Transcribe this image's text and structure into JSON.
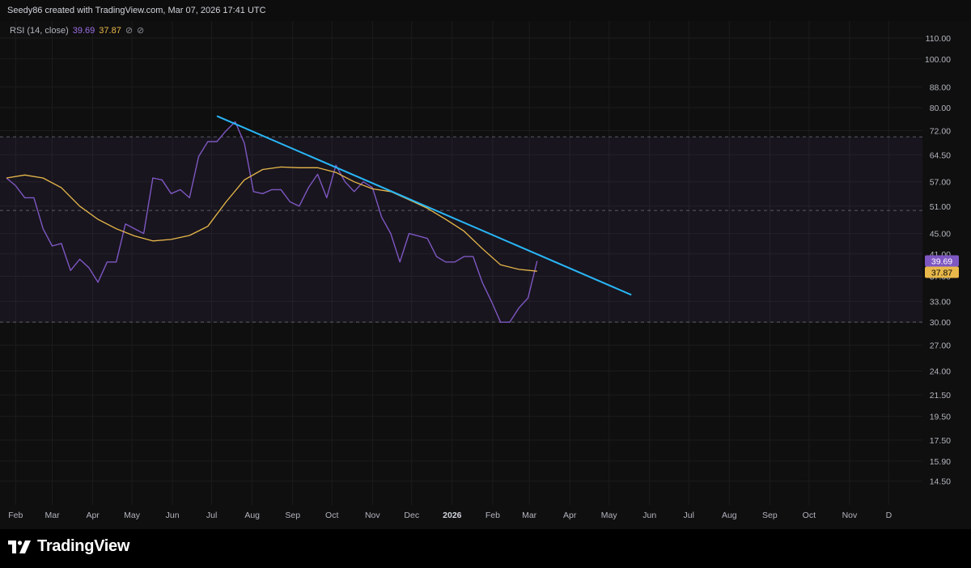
{
  "header": {
    "caption": "Seedy86 created with TradingView.com, Mar 07, 2026 17:41 UTC"
  },
  "indicator": {
    "label": "RSI (14, close)",
    "rsi_value": "39.69",
    "ma_value": "37.87",
    "icon_names": [
      "hide-icon",
      "hide-icon"
    ]
  },
  "brand": {
    "name": "TradingView"
  },
  "colors": {
    "rsi": "#7e57c2",
    "rsi_ma": "#e8b84a",
    "trendline": "#29b6f6",
    "band": "#7e57c2",
    "background": "#0f0f0f",
    "gridline": "#1c1c1c"
  },
  "chart_data": {
    "type": "line",
    "title": "",
    "xlabel": "",
    "ylabel": "",
    "y_scale": "log",
    "ylim": [
      13.5,
      115
    ],
    "y_ticks": [
      "110.00",
      "100.00",
      "88.00",
      "80.00",
      "72.00",
      "64.50",
      "57.00",
      "51.00",
      "45.00",
      "41.00",
      "37.00",
      "33.00",
      "30.00",
      "27.00",
      "24.00",
      "21.50",
      "19.50",
      "17.50",
      "15.90",
      "14.50"
    ],
    "x_ticks": [
      "Feb",
      "Mar",
      "Apr",
      "May",
      "Jun",
      "Jul",
      "Aug",
      "Sep",
      "Oct",
      "Nov",
      "Dec",
      "2026",
      "Feb",
      "Mar",
      "Apr",
      "May",
      "Jun",
      "Jul",
      "Aug",
      "Sep",
      "Oct",
      "Nov",
      "D"
    ],
    "x_start": "2025-01-25",
    "x_end": "2026-12-28",
    "bands": {
      "upper": 70,
      "middle": 50,
      "lower": 30
    },
    "grid": true,
    "legend": "top-left",
    "series": [
      {
        "name": "RSI (14, close)",
        "points": [
          [
            "2025-01-25",
            58
          ],
          [
            "2025-02-01",
            56
          ],
          [
            "2025-02-08",
            53
          ],
          [
            "2025-02-15",
            53
          ],
          [
            "2025-02-22",
            46
          ],
          [
            "2025-03-01",
            42.5
          ],
          [
            "2025-03-08",
            43
          ],
          [
            "2025-03-15",
            38
          ],
          [
            "2025-03-22",
            40
          ],
          [
            "2025-03-29",
            38.5
          ],
          [
            "2025-04-05",
            36
          ],
          [
            "2025-04-12",
            39.5
          ],
          [
            "2025-04-19",
            39.5
          ],
          [
            "2025-04-26",
            47
          ],
          [
            "2025-05-03",
            46
          ],
          [
            "2025-05-10",
            45
          ],
          [
            "2025-05-17",
            58
          ],
          [
            "2025-05-24",
            57.5
          ],
          [
            "2025-05-31",
            54
          ],
          [
            "2025-06-07",
            55
          ],
          [
            "2025-06-14",
            53
          ],
          [
            "2025-06-21",
            64
          ],
          [
            "2025-06-28",
            68.5
          ],
          [
            "2025-07-05",
            68.5
          ],
          [
            "2025-07-12",
            72
          ],
          [
            "2025-07-19",
            75
          ],
          [
            "2025-07-26",
            68
          ],
          [
            "2025-08-02",
            54.5
          ],
          [
            "2025-08-09",
            54
          ],
          [
            "2025-08-16",
            55
          ],
          [
            "2025-08-23",
            55
          ],
          [
            "2025-08-30",
            52
          ],
          [
            "2025-09-06",
            51
          ],
          [
            "2025-09-13",
            55.5
          ],
          [
            "2025-09-20",
            59
          ],
          [
            "2025-09-27",
            53
          ],
          [
            "2025-10-04",
            61.5
          ],
          [
            "2025-10-11",
            57
          ],
          [
            "2025-10-18",
            54.5
          ],
          [
            "2025-10-25",
            57
          ],
          [
            "2025-11-01",
            55.5
          ],
          [
            "2025-11-08",
            48.5
          ],
          [
            "2025-11-15",
            45
          ],
          [
            "2025-11-22",
            39.5
          ],
          [
            "2025-11-29",
            45
          ],
          [
            "2025-12-06",
            44.5
          ],
          [
            "2025-12-13",
            44
          ],
          [
            "2025-12-20",
            40.5
          ],
          [
            "2025-12-27",
            39.5
          ],
          [
            "2026-01-03",
            39.5
          ],
          [
            "2026-01-10",
            40.5
          ],
          [
            "2026-01-17",
            40.5
          ],
          [
            "2026-01-24",
            36
          ],
          [
            "2026-01-31",
            33
          ],
          [
            "2026-02-07",
            30
          ],
          [
            "2026-02-14",
            30
          ],
          [
            "2026-02-21",
            32
          ],
          [
            "2026-02-28",
            33.5
          ],
          [
            "2026-03-07",
            39.69
          ]
        ]
      },
      {
        "name": "RSI-based MA",
        "points": [
          [
            "2025-01-25",
            58
          ],
          [
            "2025-02-08",
            58.8
          ],
          [
            "2025-02-22",
            58
          ],
          [
            "2025-03-08",
            55.5
          ],
          [
            "2025-03-22",
            51
          ],
          [
            "2025-04-05",
            48
          ],
          [
            "2025-04-19",
            46
          ],
          [
            "2025-05-03",
            44.5
          ],
          [
            "2025-05-17",
            43.5
          ],
          [
            "2025-05-31",
            43.8
          ],
          [
            "2025-06-14",
            44.6
          ],
          [
            "2025-06-28",
            46.5
          ],
          [
            "2025-07-12",
            52
          ],
          [
            "2025-07-26",
            57.5
          ],
          [
            "2025-08-09",
            60.3
          ],
          [
            "2025-08-23",
            61
          ],
          [
            "2025-09-06",
            60.8
          ],
          [
            "2025-09-20",
            60.8
          ],
          [
            "2025-10-04",
            59.5
          ],
          [
            "2025-10-18",
            57
          ],
          [
            "2025-11-01",
            55.2
          ],
          [
            "2025-11-15",
            54.5
          ],
          [
            "2025-11-29",
            52.5
          ],
          [
            "2025-12-13",
            50.5
          ],
          [
            "2025-12-27",
            48
          ],
          [
            "2026-01-10",
            45.5
          ],
          [
            "2026-01-24",
            42
          ],
          [
            "2026-02-07",
            39
          ],
          [
            "2026-02-21",
            38.2
          ],
          [
            "2026-03-07",
            37.87
          ]
        ]
      },
      {
        "name": "",
        "points": [
          [
            "2025-07-05",
            77
          ],
          [
            "2026-05-18",
            34
          ]
        ]
      }
    ]
  }
}
